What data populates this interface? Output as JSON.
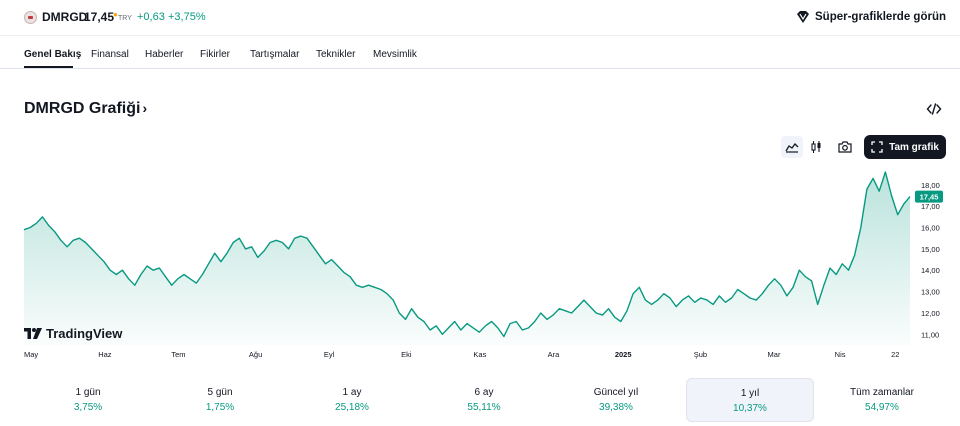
{
  "header": {
    "symbol": "DMRGD",
    "price": "17,45",
    "currency": "TRY",
    "change": "+0,63",
    "change_pct": "+3,75%",
    "super_charts_label": "Süper-grafiklerde görün",
    "logo_icon": "company-logo-icon"
  },
  "tabs": [
    {
      "label": "Genel Bakış",
      "active": true
    },
    {
      "label": "Finansal"
    },
    {
      "label": "Haberler"
    },
    {
      "label": "Fikirler"
    },
    {
      "label": "Tartışmalar"
    },
    {
      "label": "Teknikler"
    },
    {
      "label": "Mevsimlik"
    }
  ],
  "chart_section": {
    "title": "DMRGD Grafiği",
    "title_chevron": "›",
    "full_chart_label": "Tam grafik",
    "icons": [
      "embed-code-icon",
      "area-chart-icon",
      "candles-icon",
      "camera-icon",
      "fullscreen-icon"
    ],
    "branding": "TradingView",
    "price_tag": "17,45",
    "accent_color": "#089981"
  },
  "chart_data": {
    "type": "area",
    "title": "",
    "xlabel": "",
    "ylabel": "",
    "ylim": [
      10.5,
      18.6
    ],
    "y_ticks": [
      "18,00",
      "17,00",
      "16,00",
      "15,00",
      "14,00",
      "13,00",
      "12,00",
      "11,00"
    ],
    "y_tick_values": [
      18,
      17,
      16,
      15,
      14,
      13,
      12,
      11
    ],
    "x_tick_labels": [
      "May",
      "Haz",
      "Tem",
      "Ağu",
      "Eyl",
      "Eki",
      "Kas",
      "Ara",
      "2025",
      "Şub",
      "Mar",
      "Nis",
      "22"
    ],
    "x_tick_positions": [
      0,
      1.1,
      2.1,
      3.15,
      4.15,
      5.2,
      6.2,
      7.2,
      8.15,
      9.2,
      10.2,
      11.1,
      11.85
    ],
    "series": [
      {
        "x_range": [
          0,
          12.05
        ],
        "values": [
          15.9,
          16.0,
          16.2,
          16.5,
          16.1,
          15.8,
          15.4,
          15.1,
          15.4,
          15.5,
          15.3,
          15.0,
          14.7,
          14.4,
          14.0,
          13.8,
          14.0,
          13.6,
          13.3,
          13.8,
          14.2,
          14.0,
          14.1,
          13.7,
          13.3,
          13.6,
          13.8,
          13.6,
          13.4,
          13.8,
          14.3,
          14.8,
          14.4,
          14.8,
          15.3,
          15.5,
          15.0,
          15.1,
          14.6,
          14.9,
          15.3,
          15.4,
          15.3,
          15.0,
          15.5,
          15.6,
          15.5,
          15.1,
          14.7,
          14.3,
          14.5,
          14.2,
          13.9,
          13.7,
          13.3,
          13.2,
          13.3,
          13.2,
          13.1,
          12.9,
          12.6,
          12.0,
          11.7,
          12.2,
          11.8,
          11.6,
          11.2,
          11.4,
          11.0,
          11.3,
          11.6,
          11.2,
          11.5,
          11.3,
          11.1,
          11.4,
          11.6,
          11.3,
          10.9,
          11.5,
          11.6,
          11.2,
          11.3,
          11.6,
          12.0,
          11.7,
          11.9,
          12.2,
          12.1,
          12.0,
          12.3,
          12.6,
          12.3,
          12.0,
          11.9,
          12.2,
          11.8,
          11.6,
          12.1,
          12.9,
          13.2,
          12.6,
          12.4,
          12.6,
          12.9,
          12.7,
          12.3,
          12.6,
          12.8,
          12.5,
          12.7,
          12.6,
          12.4,
          12.8,
          12.5,
          12.7,
          13.1,
          12.9,
          12.7,
          12.6,
          12.9,
          13.3,
          13.6,
          13.3,
          12.8,
          13.2,
          14.0,
          13.7,
          13.5,
          12.4,
          13.3,
          14.1,
          13.8,
          14.3,
          14.0,
          14.7,
          16.0,
          17.8,
          18.3,
          17.7,
          18.6,
          17.5,
          16.6,
          17.1,
          17.45
        ]
      }
    ],
    "legend": "none",
    "grid": false,
    "current_value": 17.45
  },
  "periods": [
    {
      "label": "1 gün",
      "value": "3,75%"
    },
    {
      "label": "5 gün",
      "value": "1,75%"
    },
    {
      "label": "1 ay",
      "value": "25,18%"
    },
    {
      "label": "6 ay",
      "value": "55,11%"
    },
    {
      "label": "Güncel yıl",
      "value": "39,38%"
    },
    {
      "label": "1 yıl",
      "value": "10,37%",
      "active": true
    },
    {
      "label": "Tüm zamanlar",
      "value": "54,97%"
    }
  ]
}
